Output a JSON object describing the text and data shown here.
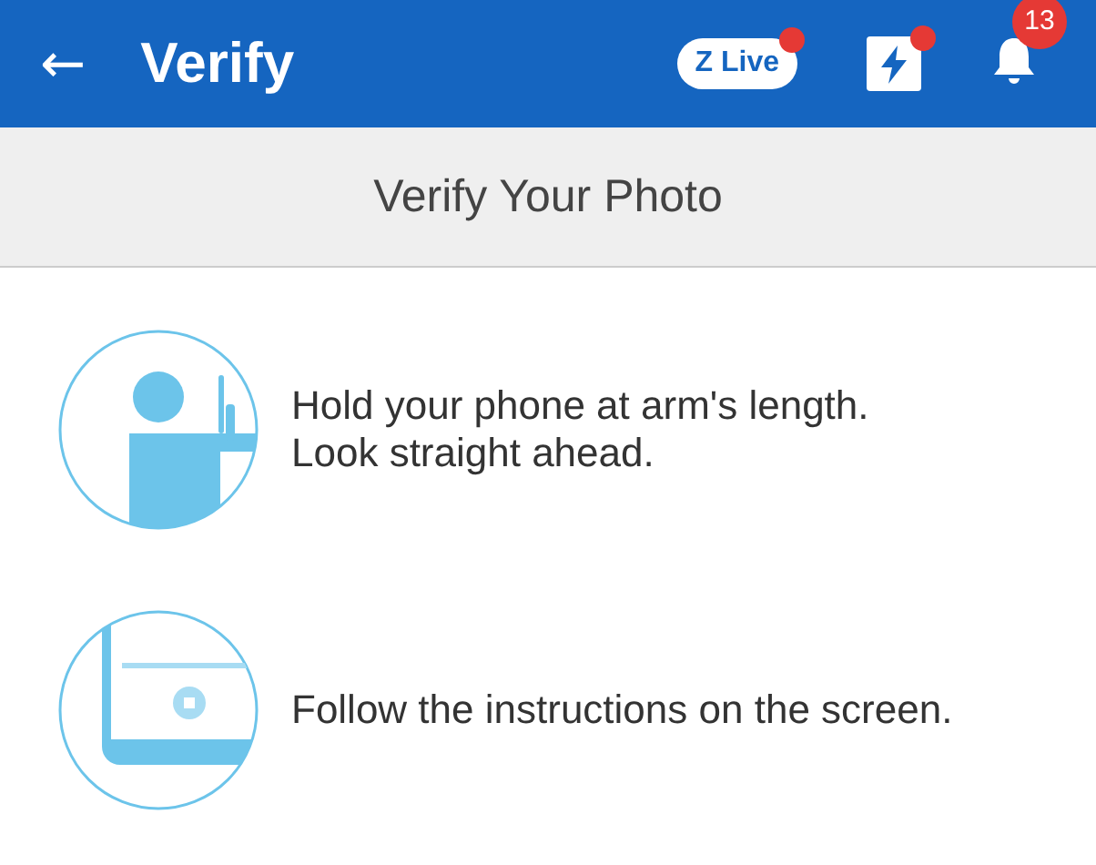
{
  "app_bar": {
    "back": "←",
    "title": "Verify",
    "live_badge": {
      "label": "Z Live",
      "unread": true
    },
    "flash": {
      "unread": true
    },
    "notifications": {
      "count": "13"
    }
  },
  "section_header": "Verify Your Photo",
  "steps": [
    {
      "kind": "arm",
      "text": "Hold your phone at arm's length. Look straight ahead."
    },
    {
      "kind": "screen",
      "text": "Follow the instructions on the screen."
    }
  ]
}
